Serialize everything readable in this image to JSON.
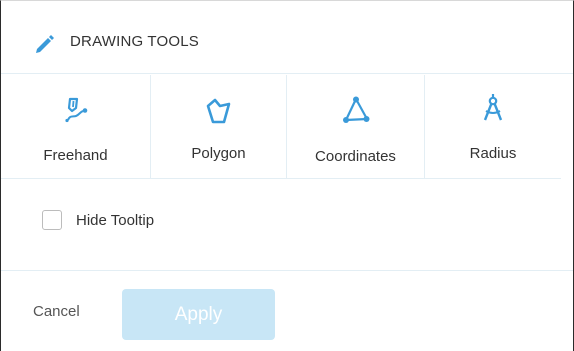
{
  "header": {
    "title": "DRAWING TOOLS",
    "icon": "pencil-icon"
  },
  "tools": [
    {
      "label": "Freehand",
      "icon": "freehand-pen-icon"
    },
    {
      "label": "Polygon",
      "icon": "polygon-icon"
    },
    {
      "label": "Coordinates",
      "icon": "triangle-coordinates-icon"
    },
    {
      "label": "Radius",
      "icon": "compass-icon"
    }
  ],
  "option": {
    "label": "Hide Tooltip",
    "checked": false
  },
  "footer": {
    "cancel_label": "Cancel",
    "apply_label": "Apply"
  },
  "colors": {
    "accent": "#3a9ad9",
    "apply_disabled_bg": "#c8e6f6",
    "divider": "#e3eef4",
    "text": "#333333"
  }
}
